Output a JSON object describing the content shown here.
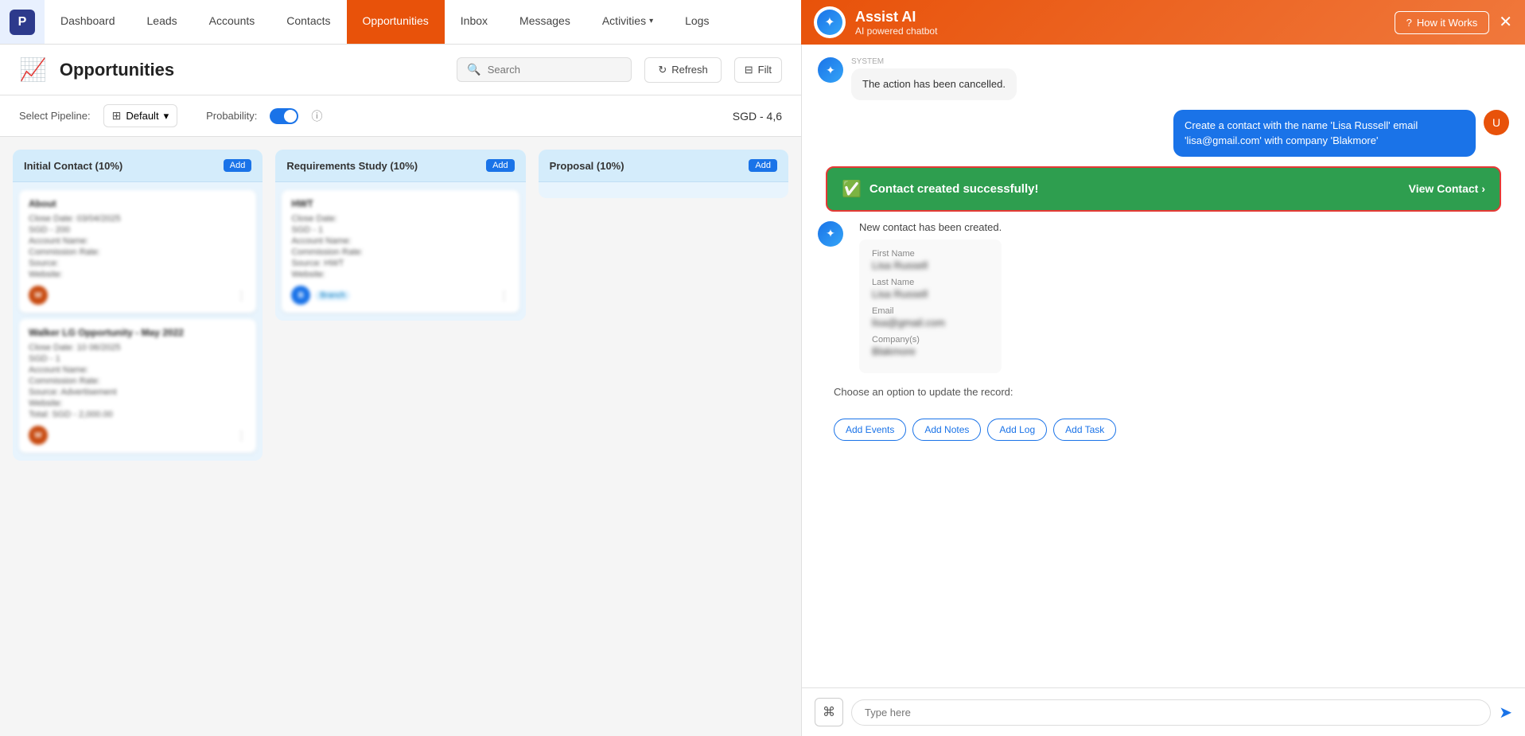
{
  "nav": {
    "logo_text": "P",
    "items": [
      {
        "label": "Dashboard",
        "active": false
      },
      {
        "label": "Leads",
        "active": false
      },
      {
        "label": "Accounts",
        "active": false
      },
      {
        "label": "Contacts",
        "active": false
      },
      {
        "label": "Opportunities",
        "active": true
      },
      {
        "label": "Inbox",
        "active": false
      },
      {
        "label": "Messages",
        "active": false
      },
      {
        "label": "Activities",
        "active": false,
        "has_chevron": true
      },
      {
        "label": "Logs",
        "active": false
      }
    ]
  },
  "assist_ai": {
    "title": "Assist AI",
    "subtitle": "AI powered chatbot",
    "how_it_works_label": "How it Works",
    "close_label": "✕"
  },
  "opportunities": {
    "title": "Opportunities",
    "search_placeholder": "Search",
    "refresh_label": "Refresh",
    "filter_label": "Filt",
    "pipeline_label": "Select Pipeline:",
    "pipeline_value": "Default",
    "probability_label": "Probability:",
    "sgd_amount": "SGD - 4,6",
    "kanban_columns": [
      {
        "title": "Initial Contact (10%)",
        "add_label": "Add",
        "cards": [
          {
            "title": "About",
            "close_date": "Close Date: 03/04/2025",
            "amount": "SGD - 200",
            "account_name": "Account Name:",
            "commission_rate": "Commission Rate:",
            "source": "Source:",
            "website": "Website:",
            "tags": "",
            "avatar": "W",
            "has_link": true
          },
          {
            "title": "Walker LG Opportunity - May 2022",
            "close_date": "Close Date: 10 06/2025",
            "amount": "SGD - 1",
            "account_name": "Account Name:",
            "commission_rate": "Commission Rate:",
            "source": "Source: Advertisement",
            "website": "Website:",
            "tags": "",
            "total": "Total: SGD - 2,000.00",
            "avatar": "W"
          }
        ]
      },
      {
        "title": "Requirements Study (10%)",
        "add_label": "Add",
        "cards": [
          {
            "title": "HWT",
            "close_date": "Close Date:",
            "amount": "SGD - 1",
            "account_name": "Account Name:",
            "commission_rate": "Commission Rate:",
            "source": "Source: HWT",
            "website": "Website:",
            "tags": "Branch",
            "avatar": "B",
            "avatar_color": "blue"
          }
        ]
      },
      {
        "title": "Proposal (10%)",
        "add_label": "Add",
        "cards": []
      }
    ]
  },
  "chat": {
    "messages": [
      {
        "type": "ai",
        "text": "The action has been cancelled.",
        "label": "SYSTEM"
      },
      {
        "type": "user",
        "text": "Create a contact with the name 'Lisa Russell' email 'lisa@gmail.com' with company 'Blakmore'",
        "label": ""
      }
    ],
    "success_banner": {
      "text": "Contact created successfully!",
      "view_label": "View Contact",
      "view_chevron": "›"
    },
    "new_contact_message": "New contact has been created.",
    "contact_details": {
      "first_name_label": "First Name",
      "first_name_value": "Lisa Russell",
      "last_name_label": "Last Name",
      "last_name_value": "Lisa Russell",
      "email_label": "Email",
      "email_value": "lisa@gmail.com",
      "company_label": "Company(s)",
      "company_value": "Blakmore"
    },
    "choose_action_text": "Choose an option to update the record:",
    "action_buttons": [
      {
        "label": "Add Events"
      },
      {
        "label": "Add Notes"
      },
      {
        "label": "Add Log"
      },
      {
        "label": "Add Task"
      }
    ],
    "input_placeholder": "Type here",
    "send_icon": "➤"
  }
}
